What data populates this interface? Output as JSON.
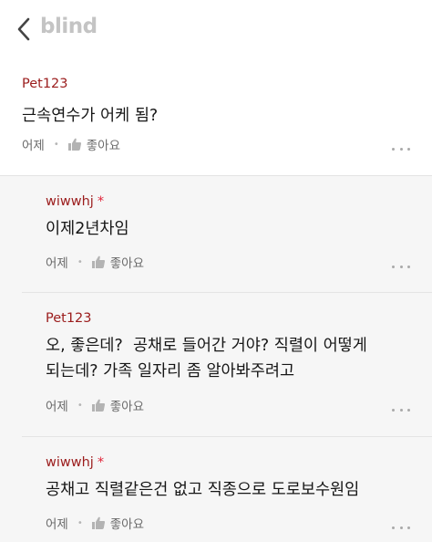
{
  "header": {
    "logo_text": "blind",
    "back_icon": "chevron-left-icon"
  },
  "comments": [
    {
      "author": "Pet123",
      "author_badge": "",
      "text": "근속연수가 어케 됨?",
      "time": "어제",
      "like_label": "좋아요"
    },
    {
      "author": "wiwwhj",
      "author_badge": "*",
      "text": "이제2년차임",
      "time": "어제",
      "like_label": "좋아요"
    },
    {
      "author": "Pet123",
      "author_badge": "",
      "text_line1": "오, 좋은데?  공채로 들어간 거야? 직렬이 어떻게",
      "text_line2": "되는데? 가족 일자리 좀 알아봐주려고",
      "time": "어제",
      "like_label": "좋아요"
    },
    {
      "author": "wiwwhj",
      "author_badge": "*",
      "text": "공채고 직렬같은건 없고 직종으로 도로보수원임",
      "time": "어제",
      "like_label": "좋아요"
    }
  ],
  "colors": {
    "author": "#9b1c1c",
    "badge": "#e0253a",
    "logo": "#c4c4c4",
    "reply_bg": "#f6f6f6"
  }
}
